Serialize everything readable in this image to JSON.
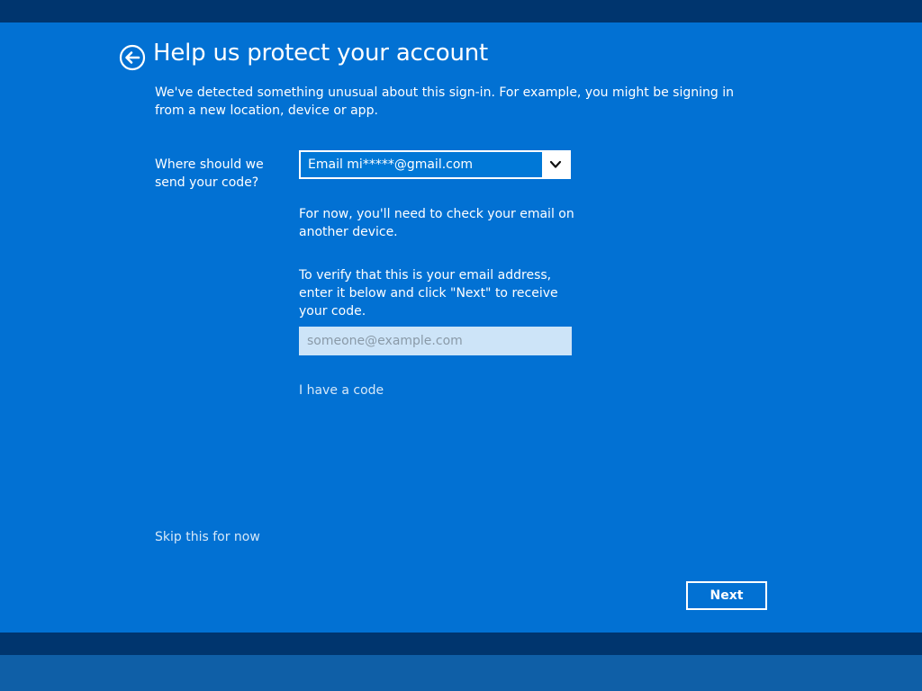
{
  "page": {
    "title": "Help us protect your account",
    "intro": "We've detected something unusual about this sign-in. For example, you might be signing in from a new location, device or app."
  },
  "verify": {
    "send_label": "Where should we send your code?",
    "method_selected": "Email mi*****@gmail.com",
    "note_other_device": "For now, you'll need to check your email on another device.",
    "note_enter_email": "To verify that this is your email address, enter it below and click \"Next\" to receive your code.",
    "email_placeholder": "someone@example.com",
    "email_value": "",
    "have_code_link": "I have a code"
  },
  "footer": {
    "skip_link": "Skip this for now",
    "next_label": "Next"
  },
  "colors": {
    "background": "#0271d3",
    "strip": "#00356e",
    "select_fill": "#0078d7",
    "input_fill": "#cde4f8"
  },
  "icons": {
    "back": "back-arrow-circle-icon",
    "dropdown": "chevron-down-icon"
  }
}
